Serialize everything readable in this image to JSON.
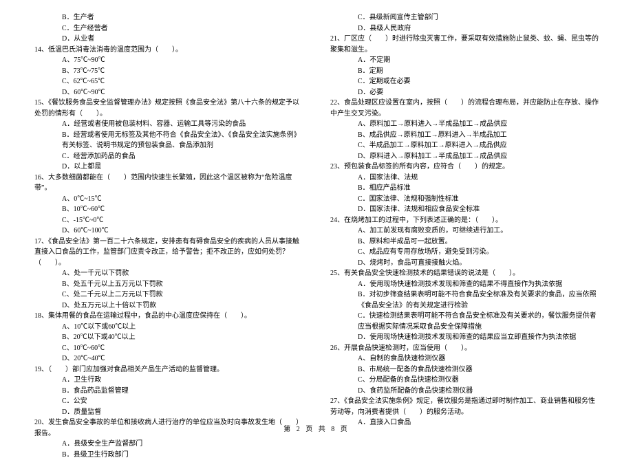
{
  "left": [
    {
      "cls": "opt",
      "t": "B．生产者"
    },
    {
      "cls": "opt",
      "t": "C．生产经营者"
    },
    {
      "cls": "opt",
      "t": "D．从业者"
    },
    {
      "cls": "q",
      "t": "14、低温巴氏消毒法消毒的温度范围为（　　）。"
    },
    {
      "cls": "opt",
      "t": "A、75℃~90℃"
    },
    {
      "cls": "opt",
      "t": "B、73℃~75℃"
    },
    {
      "cls": "opt",
      "t": "C、62℃~65℃"
    },
    {
      "cls": "opt",
      "t": "D、60℃~90℃"
    },
    {
      "cls": "q",
      "t": "15、《餐饮服务食品安全监督管理办法》规定按照《食品安全法》第八十六条的规定予以处罚的情形有（　　）。"
    },
    {
      "cls": "opt",
      "t": "A．经营或者使用被包装材料、容器、运输工具等污染的食品"
    },
    {
      "cls": "opt",
      "t": "B．经营或者使用无标签及其他不符合《食品安全法》、《食品安全法实施条例》有关标签、说明书规定的预包装食品、食品添加剂"
    },
    {
      "cls": "opt",
      "t": "C．经营添加药品的食品"
    },
    {
      "cls": "opt",
      "t": "D．以上都是"
    },
    {
      "cls": "q",
      "t": "16、大多数细菌都能在（　　）范围内快速生长繁殖，因此这个温区被称为“危险温度带”。"
    },
    {
      "cls": "opt",
      "t": "A、0℃~15℃"
    },
    {
      "cls": "opt",
      "t": "B、10℃~60℃"
    },
    {
      "cls": "opt",
      "t": "C、-15℃~0℃"
    },
    {
      "cls": "opt",
      "t": "D、60℃~100℃"
    },
    {
      "cls": "q",
      "t": "17、《食品安全法》第一百二十六条规定，安排患有有碍食品安全的疾病的人员从事接触直接入口食品的工作，监管部门应责令改正，给予警告；拒不改正的，应如何处罚？（　　）。"
    },
    {
      "cls": "opt",
      "t": "A、处一千元以下罚款"
    },
    {
      "cls": "opt",
      "t": "B、处五千元以上五万元以下罚款"
    },
    {
      "cls": "opt",
      "t": "C、处二千元以上二万元以下罚款"
    },
    {
      "cls": "opt",
      "t": "D、处五万元以上十倍以下罚款"
    },
    {
      "cls": "q",
      "t": "18、集体用餐的食品在运输过程中，食品的中心温度应保持在（　　）。"
    },
    {
      "cls": "opt",
      "t": "A、10℃以下或60℃以上"
    },
    {
      "cls": "opt",
      "t": "B、20℃以下或40℃以上"
    },
    {
      "cls": "opt",
      "t": "C、10℃~60℃"
    },
    {
      "cls": "opt",
      "t": "D、20℃~40℃"
    },
    {
      "cls": "q",
      "t": "19、（　　）部门应加强对食品相关产品生产活动的监督管理。"
    },
    {
      "cls": "opt",
      "t": "A．卫生行政"
    },
    {
      "cls": "opt",
      "t": "B．食品药品监督管理"
    },
    {
      "cls": "opt",
      "t": "C．公安"
    },
    {
      "cls": "opt",
      "t": "D．质量监督"
    },
    {
      "cls": "q",
      "t": "20、发生食品安全事故的单位和接收病人进行治疗的单位应当及时向事故发生地（　　）报告。"
    },
    {
      "cls": "opt",
      "t": "A．县级安全生产监督部门"
    },
    {
      "cls": "opt",
      "t": "B．县级卫生行政部门"
    }
  ],
  "right": [
    {
      "cls": "opt",
      "t": "C．县级新闻宣传主管部门"
    },
    {
      "cls": "opt",
      "t": "D．县级人民政府"
    },
    {
      "cls": "q",
      "t": "21、厂区应（　　）时进行除虫灭害工作，要采取有效措施防止鼠类、蚊、蝇、昆虫等的聚集和滋生。"
    },
    {
      "cls": "opt",
      "t": "A．不定期"
    },
    {
      "cls": "opt",
      "t": "B．定期"
    },
    {
      "cls": "opt",
      "t": "C．定期或在必要"
    },
    {
      "cls": "opt",
      "t": "D．必要"
    },
    {
      "cls": "q",
      "t": "22、食品处理区应设置在室内，按照（　　）的流程合理布局，并应能防止在存放、操作中产生交叉污染。"
    },
    {
      "cls": "opt",
      "t": "A、原料加工→原料进入→半成品加工→成品供应"
    },
    {
      "cls": "opt",
      "t": "B、成品供应→原料加工→原料进入→半成品加工"
    },
    {
      "cls": "opt",
      "t": "C、半成品加工→原料加工→原料进入→成品供应"
    },
    {
      "cls": "opt",
      "t": "D、原料进入→原料加工→半成品加工→成品供应"
    },
    {
      "cls": "q",
      "t": "23、预包装食品标签的所有内容，应符合（　　）的规定。"
    },
    {
      "cls": "opt",
      "t": "A．国家法律、法规"
    },
    {
      "cls": "opt",
      "t": "B．相应产品标准"
    },
    {
      "cls": "opt",
      "t": "C．国家法律、法规和强制性标准"
    },
    {
      "cls": "opt",
      "t": "D．国家法律、法规和相应食品安全标准"
    },
    {
      "cls": "q",
      "t": "24、在烧烤加工的过程中，下列表述正确的是：（　　）。"
    },
    {
      "cls": "opt",
      "t": "A、加工前发现有腐败变质的，可继续进行加工。"
    },
    {
      "cls": "opt",
      "t": "B、原料和半成品可一起放置。"
    },
    {
      "cls": "opt",
      "t": "C、成品应有专用存放场所，避免受到污染。"
    },
    {
      "cls": "opt",
      "t": "D、烧烤时，食品可直接接触火焰。"
    },
    {
      "cls": "q",
      "t": "25、有关食品安全快速检测技术的结果错误的说法是（　　）。"
    },
    {
      "cls": "opt",
      "t": "A．使用现场快速检测技术发现和筛查的结果不得直接作为执法依据"
    },
    {
      "cls": "opt",
      "t": "B．对初步筛查结果表明可能不符合食品安全标准及有关要求的食品，应当依照《食品安全法》的有关规定进行检验"
    },
    {
      "cls": "opt",
      "t": "C．快速检测结果表明可能不符合食品安全标准及有关要求的，餐饮服务提供者应当根据实际情况采取食品安全保障措施"
    },
    {
      "cls": "opt",
      "t": "D．使用现场快速检测技术发现和筛查的结果应当立即直接作为执法依据"
    },
    {
      "cls": "q",
      "t": "26、开展食品快速检测时，应当使用（　　）。"
    },
    {
      "cls": "opt",
      "t": "A、自制的食品快速检测仪器"
    },
    {
      "cls": "opt",
      "t": "B、市局统一配备的食品快速检测仪器"
    },
    {
      "cls": "opt",
      "t": "C、分局配备的食品快速检测仪器"
    },
    {
      "cls": "opt",
      "t": "D、食药监所配备的食品快速检测仪器"
    },
    {
      "cls": "q",
      "t": "27、《食品安全法实施条例》规定，餐饮服务是指通过即时制作加工、商业销售和服务性劳动等，向消费者提供（　　）的服务活动。"
    },
    {
      "cls": "opt",
      "t": "A．直接入口食品"
    }
  ],
  "footer": "第 2 页 共 8 页"
}
